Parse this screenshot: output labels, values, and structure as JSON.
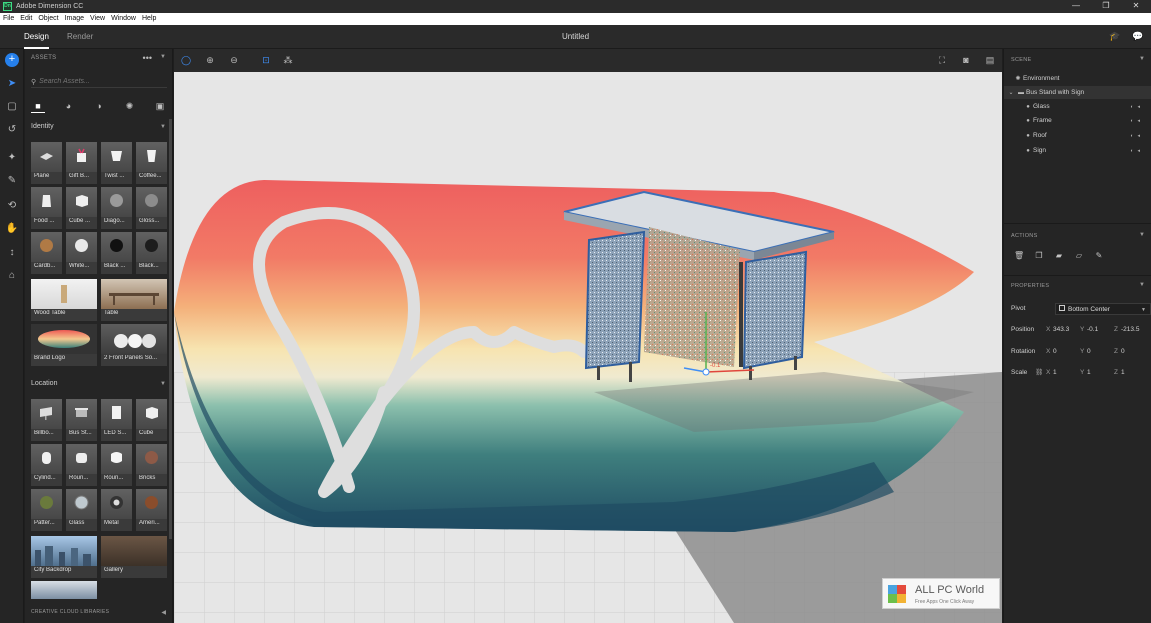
{
  "window": {
    "title": "Adobe Dimension CC",
    "logo_text": "Dn",
    "minimize": "—",
    "restore": "❐",
    "close": "✕"
  },
  "menu": [
    "File",
    "Edit",
    "Object",
    "Image",
    "View",
    "Window",
    "Help"
  ],
  "modes": {
    "design": "Design",
    "render": "Render"
  },
  "document_title": "Untitled",
  "assets": {
    "header": "ASSETS",
    "more": "•••",
    "search_placeholder": "Search Assets...",
    "sections": {
      "identity": {
        "title": "Identity",
        "tiles": [
          "Plane",
          "Gift B...",
          "Twist ...",
          "Coffee...",
          "Food ...",
          "Cube ...",
          "Diago...",
          "Gloss...",
          "Cardb...",
          "White...",
          "Black ...",
          "Black..."
        ],
        "wide_tiles": [
          "Wood Table",
          "Table",
          "Brand Logo",
          "2 Front Panels So..."
        ]
      },
      "location": {
        "title": "Location",
        "tiles": [
          "Billbo...",
          "Bus St...",
          "LED S...",
          "Cube",
          "Cylind...",
          "Roun...",
          "Roun...",
          "Bricks",
          "Patter...",
          "Glass",
          "Metal",
          "Ameri..."
        ],
        "wide_tiles": [
          "City Backdrop",
          "Gallery"
        ]
      }
    },
    "footer": "CREATIVE CLOUD LIBRARIES"
  },
  "scene": {
    "header": "SCENE",
    "items": [
      {
        "label": "Environment",
        "level": 0
      },
      {
        "label": "Bus Stand with Sign",
        "level": 0
      },
      {
        "label": "Glass",
        "level": 1
      },
      {
        "label": "Frame",
        "level": 1
      },
      {
        "label": "Roof",
        "level": 1
      },
      {
        "label": "Sign",
        "level": 1
      }
    ]
  },
  "actions": {
    "header": "ACTIONS"
  },
  "properties": {
    "header": "PROPERTIES",
    "pivot_label": "Pivot",
    "pivot_value": "Bottom Center",
    "position_label": "Position",
    "position": {
      "x": "343.3",
      "y": "-0.1",
      "z": "-213.5"
    },
    "rotation_label": "Rotation",
    "rotation": {
      "x": "0",
      "y": "0",
      "z": "0"
    },
    "scale_label": "Scale",
    "scale": {
      "x": "1",
      "y": "1",
      "z": "1"
    },
    "axis": {
      "x": "X",
      "y": "Y",
      "z": "Z"
    }
  },
  "gizmo_value": "-0.1",
  "watermark": {
    "title": "ALL PC World",
    "subtitle": "Free Apps One Click Away"
  },
  "colors": {
    "accent": "#2680eb",
    "selection": "#3f8ef5"
  }
}
